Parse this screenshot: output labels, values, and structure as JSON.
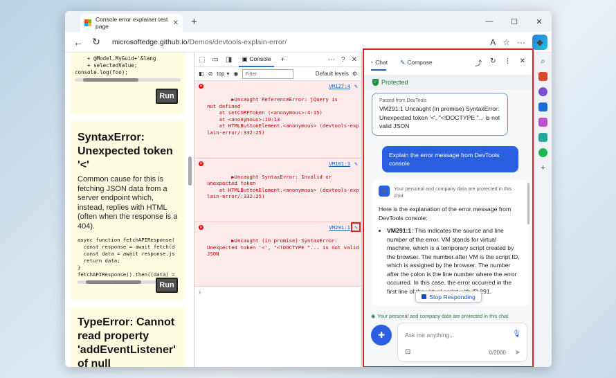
{
  "browser": {
    "tab_title": "Console error explainer test page",
    "tab_close": "✕",
    "new_tab": "+",
    "url_host": "microsoftedge.github.io",
    "url_path": "/Demos/devtools-explain-error/"
  },
  "page": {
    "code1": "    + @Model.MyGuid+'&lang\n    + selectedValue;\nconsole.log(foo);",
    "run_label": "Run",
    "syntax_heading": "SyntaxError: Unexpected token '<'",
    "syntax_body": "Common cause for this is fetching JSON data from a server endpoint which, instead, replies with HTML (often when the response is a 404).",
    "code2": "async function fetchAPIResponse(\n  const response = await fetch(d\n  const data = await response.js\n  return data;\n}\nfetchAPIResponse().then((data) =",
    "type_heading": "TypeError: Cannot read property 'addEventListener' of null"
  },
  "devtools": {
    "console_tab": "Console",
    "context": "top",
    "filter_placeholder": "Filter",
    "levels": "Default levels",
    "messages": [
      {
        "text": "▶Uncaught ReferenceError: jQuery is\nnot defined\n    at setCSRFToken (<anonymous>:4:15)\n    at <anonymous>:10:13\n    at HTMLButtonElement.<anonymous> (devtools-exp\nlain-error/:332:25)",
        "link": "VM127:4"
      },
      {
        "text": "▶Uncaught SyntaxError: Invalid or\nunexpected token\n    at HTMLButtonElement.<anonymous> (devtools-exp\nlain-error/:332:25)",
        "link": "VM161:3"
      },
      {
        "text": "▶Uncaught (in promise) SyntaxError:\nUnexpected token '<', \"<!DOCTYPE \"... is not valid\nJSON",
        "link": "VM291:1"
      }
    ]
  },
  "copilot": {
    "chat_tab": "Chat",
    "compose_tab": "Compose",
    "protected": "Protected",
    "pasted_label": "Pasted from DevTools",
    "pasted_text": "VM291:1 Uncaught (in promise) SyntaxError: Unexpected token '<', \"<!DOCTYPE \"... is not valid JSON",
    "user_message": "Explain the error message from DevTools console",
    "answer_privacy": "Your personal and company data are protected in this chat",
    "answer_intro": "Here is the explanation of the error message from DevTools console:",
    "bullet_term": "VM291:1",
    "bullet_text": ": This indicates the source and line number of the error. VM stands for virtual machine, which is a temporary script created by the browser. The number after VM is the script ID, which is assigned by the browser. The number after the colon is the line number where the error occurred. In this case, the error occurred in the first line of the virtual script with ID 291.",
    "stop_label": "Stop Responding",
    "privacy_footer": "Your personal and company data are protected in this chat",
    "input_placeholder": "Ask me anything...",
    "char_count": "0/2000"
  }
}
